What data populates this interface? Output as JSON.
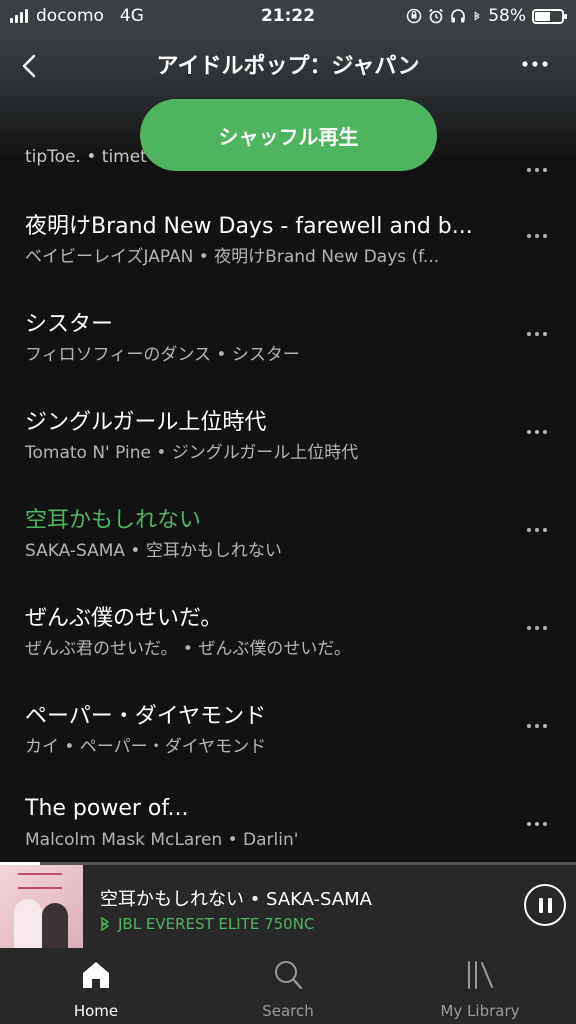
{
  "status_bar": {
    "carrier": "docomo",
    "network": "4G",
    "time": "21:22",
    "battery_percent": "58%",
    "battery_level": 0.58
  },
  "header": {
    "title": "アイドルポップ：ジャパン",
    "shuffle_label": "シャッフル再生"
  },
  "tracks": [
    {
      "title": "",
      "subtitle": "tipToe. • timet"
    },
    {
      "title": "夜明けBrand New Days - farewell and b...",
      "subtitle": "ベイビーレイズJAPAN • 夜明けBrand New Days (f..."
    },
    {
      "title": "シスター",
      "subtitle": "フィロソフィーのダンス • シスター"
    },
    {
      "title": "ジングルガール上位時代",
      "subtitle": "Tomato N' Pine • ジングルガール上位時代"
    },
    {
      "title": "空耳かもしれない",
      "subtitle": "SAKA-SAMA • 空耳かもしれない"
    },
    {
      "title": "ぜんぶ僕のせいだ。",
      "subtitle": "ぜんぶ君のせいだ。 • ぜんぶ僕のせいだ。"
    },
    {
      "title": "ペーパー・ダイヤモンド",
      "subtitle": "カイ • ペーパー・ダイヤモンド"
    },
    {
      "title": "The power of...",
      "subtitle": "Malcolm Mask McLaren • Darlin'"
    }
  ],
  "now_playing": {
    "title": "空耳かもしれない • SAKA-SAMA",
    "device": "JBL EVEREST ELITE 750NC",
    "progress": 0.07
  },
  "tabs": [
    {
      "label": "Home",
      "icon": "home-icon",
      "active": true
    },
    {
      "label": "Search",
      "icon": "search-icon",
      "active": false
    },
    {
      "label": "My Library",
      "icon": "library-icon",
      "active": false
    }
  ],
  "colors": {
    "accent": "#4fb45f",
    "background": "#121212",
    "secondary_text": "#b3b3b3"
  }
}
